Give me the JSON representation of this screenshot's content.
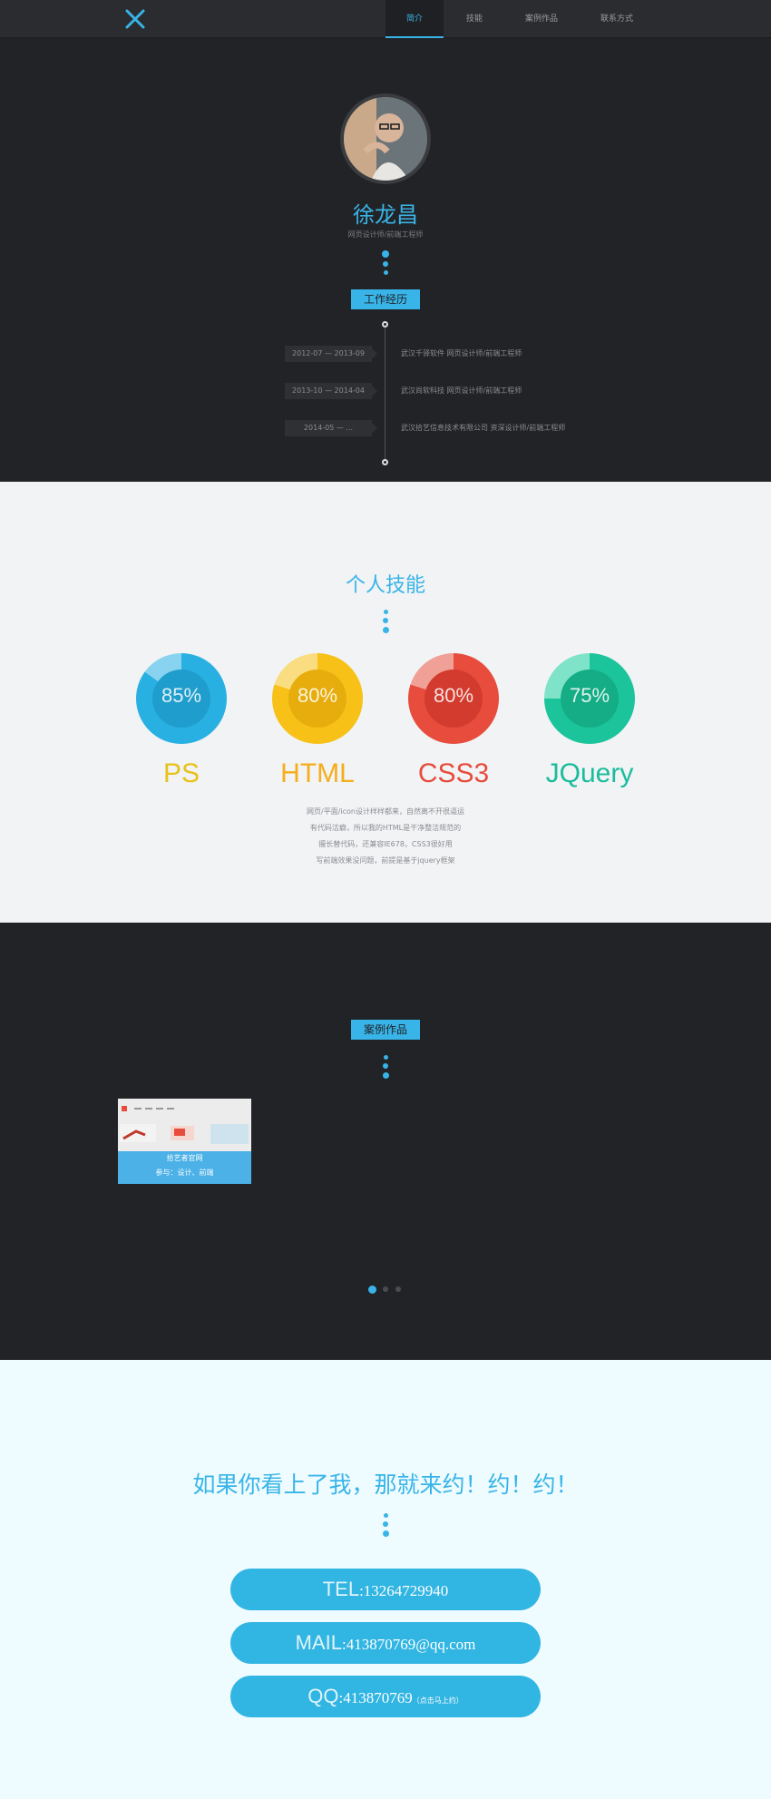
{
  "nav": {
    "items": [
      "简介",
      "技能",
      "案例作品",
      "联系方式"
    ],
    "active": 0
  },
  "intro": {
    "name": "徐龙昌",
    "subtitle": "网页设计师/前端工程师",
    "section_tag": "工作经历",
    "timeline": [
      {
        "date": "2012-07 — 2013-09",
        "text": "武汉千驿软件 网页设计师/前端工程师"
      },
      {
        "date": "2013-10 — 2014-04",
        "text": "武汉尚软科技 网页设计师/前端工程师"
      },
      {
        "date": "2014-05 — ...",
        "text": "武汉拾艺信息技术有限公司 资深设计师/前端工程师"
      }
    ]
  },
  "skills": {
    "title": "个人技能",
    "items": [
      {
        "name": "PS",
        "percent": 85,
        "percent_label": "85%",
        "ring": "#29b0e2",
        "inner": "#1f9dcc",
        "light": "#88d3ef",
        "text_color": "#e8c21a"
      },
      {
        "name": "HTML",
        "percent": 80,
        "percent_label": "80%",
        "ring": "#f7c117",
        "inner": "#e6ad0d",
        "light": "#fadd80",
        "text_color": "#f6ad1a"
      },
      {
        "name": "CSS3",
        "percent": 80,
        "percent_label": "80%",
        "ring": "#e74c3c",
        "inner": "#d23b2d",
        "light": "#f0a096",
        "text_color": "#e74c3c"
      },
      {
        "name": "JQuery",
        "percent": 75,
        "percent_label": "75%",
        "ring": "#1bc49a",
        "inner": "#14ad86",
        "light": "#7fe3c9",
        "text_color": "#1abc9c"
      }
    ],
    "description": [
      "网页/平面/icon设计样样都来，自然离不开很逼运",
      "有代码洁癖，所以我的HTML是干净整洁规范的",
      "擅长替代码，还兼容IE678，CSS3很好用",
      "写前端效果没问题，前提是基于jquery框架"
    ]
  },
  "works": {
    "section_tag": "案例作品",
    "cards": [
      {
        "title": "拾艺者官网",
        "role": "参与：设计、前端"
      }
    ],
    "pages": 3,
    "active_page": 0
  },
  "contact": {
    "title": "如果你看上了我，那就来约！约！约！",
    "tel_key": "TEL",
    "tel_value": ":13264729940",
    "mail_key": "MAIL",
    "mail_value": ":413870769@qq.com",
    "qq_key": "QQ",
    "qq_value": ":413870769",
    "qq_note": "（点击马上约）"
  },
  "colors": {
    "accent": "#39b4e8",
    "dark_bg": "#222326",
    "light_bg": "#f1f3f5",
    "contact_bg": "#eefcff"
  }
}
